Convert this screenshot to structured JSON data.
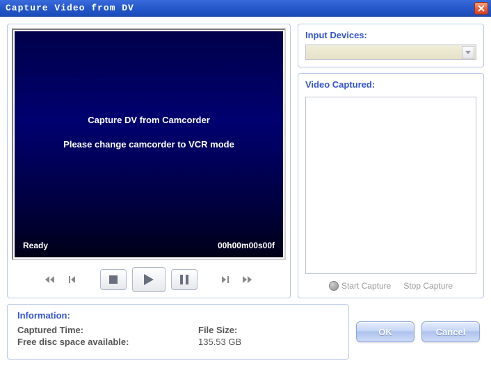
{
  "window": {
    "title": "Capture Video from DV"
  },
  "video": {
    "message1": "Capture DV from Camcorder",
    "message2": "Please change camcorder to VCR mode",
    "status": "Ready",
    "timecode": "00h00m00s00f"
  },
  "panels": {
    "input_devices_label": "Input Devices:",
    "input_device_value": "",
    "video_captured_label": "Video Captured:",
    "start_capture": "Start Capture",
    "stop_capture": "Stop Capture"
  },
  "info": {
    "header": "Information:",
    "captured_time_label": "Captured Time:",
    "captured_time_value": "",
    "file_size_label": "File Size:",
    "file_size_value": "",
    "free_space_label": "Free disc space available:",
    "free_space_value": "135.53 GB"
  },
  "buttons": {
    "ok": "OK",
    "cancel": "Cancel"
  }
}
